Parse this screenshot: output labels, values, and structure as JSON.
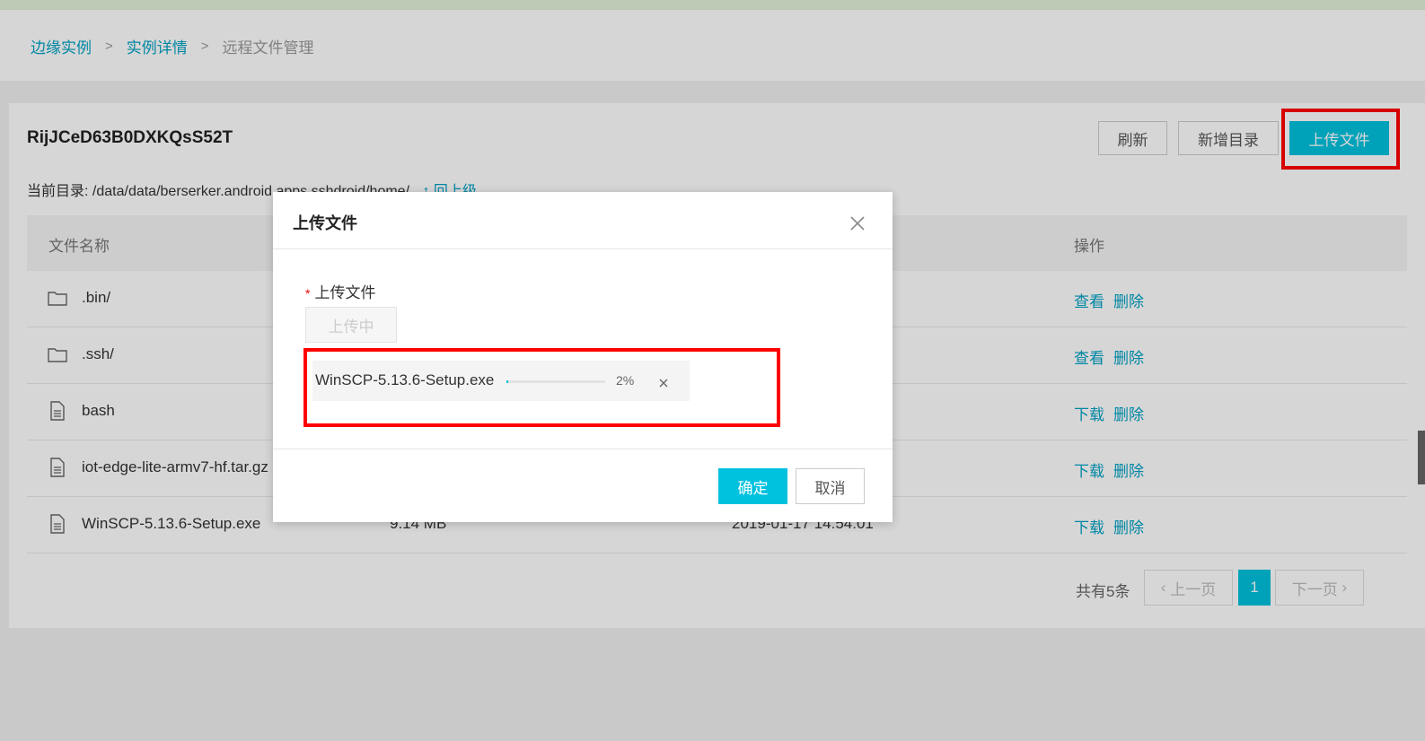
{
  "breadcrumb": {
    "items": [
      "边缘实例",
      "实例详情",
      "远程文件管理"
    ],
    "separator": ">"
  },
  "instance": {
    "id": "RijJCeD63B0DXKQsS52T"
  },
  "toolbar": {
    "refresh_label": "刷新",
    "new_dir_label": "新增目录",
    "upload_label": "上传文件"
  },
  "current_dir": {
    "label": "当前目录:",
    "path": "/data/data/berserker.android.apps.sshdroid/home/",
    "up_label": "回上级"
  },
  "table": {
    "columns": [
      "文件名称",
      "操作"
    ],
    "rows": [
      {
        "name": ".bin/",
        "type": "folder",
        "size": "",
        "date": "",
        "actions": [
          "查看",
          "删除"
        ]
      },
      {
        "name": ".ssh/",
        "type": "folder",
        "size": "",
        "date": "",
        "actions": [
          "查看",
          "删除"
        ]
      },
      {
        "name": "bash",
        "type": "file",
        "size": "",
        "date": "",
        "actions": [
          "下载",
          "删除"
        ]
      },
      {
        "name": "iot-edge-lite-armv7-hf.tar.gz",
        "type": "file",
        "size": "",
        "date": "",
        "actions": [
          "下载",
          "删除"
        ]
      },
      {
        "name": "WinSCP-5.13.6-Setup.exe",
        "type": "file",
        "size": "9.14 MB",
        "date": "2019-01-17 14:54:01",
        "actions": [
          "下载",
          "删除"
        ]
      }
    ]
  },
  "pagination": {
    "total_label": "共有5条",
    "prev_label": "上一页",
    "next_label": "下一页",
    "current_page": "1"
  },
  "modal": {
    "title": "上传文件",
    "field_label": "上传文件",
    "required_mark": "*",
    "upload_button_label": "上传中",
    "file": {
      "name": "WinSCP-5.13.6-Setup.exe",
      "progress_label": "2%",
      "progress": 0.02
    },
    "confirm_label": "确定",
    "cancel_label": "取消"
  },
  "colors": {
    "accent": "#00c1de",
    "link": "#00a1c4",
    "highlight": "#ff0000"
  }
}
